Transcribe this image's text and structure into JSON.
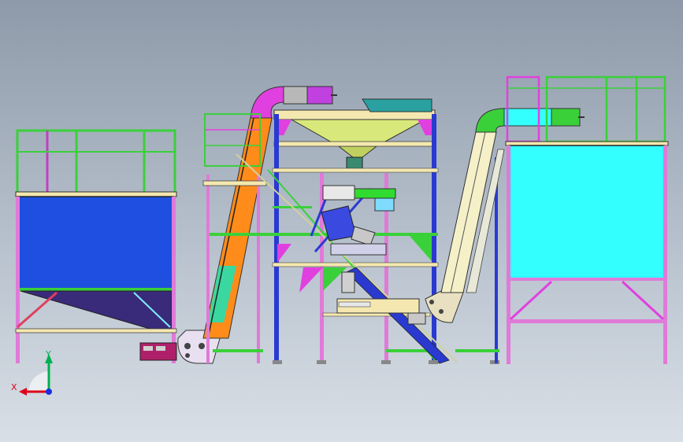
{
  "viewport": {
    "background_top": "#8e9aa9",
    "background_bottom": "#d9dfe6"
  },
  "triad": {
    "x_label": "X",
    "y_label": "Y",
    "x_color": "#e0001a",
    "y_color": "#00b050",
    "z_color": "#1a2fe0"
  },
  "palette": {
    "left_hopper": "#1f4fe0",
    "left_hopper_bottom": "#3a2a7a",
    "orange_conveyor": "#ff8c1a",
    "magenta_head": "#e040e0",
    "cyan_hopper": "#33ffff",
    "cream_conveyor": "#f5f0c8",
    "green_rail": "#2fdc2f",
    "frame_blue": "#2a3ad0",
    "frame_pink": "#e07ad8"
  }
}
